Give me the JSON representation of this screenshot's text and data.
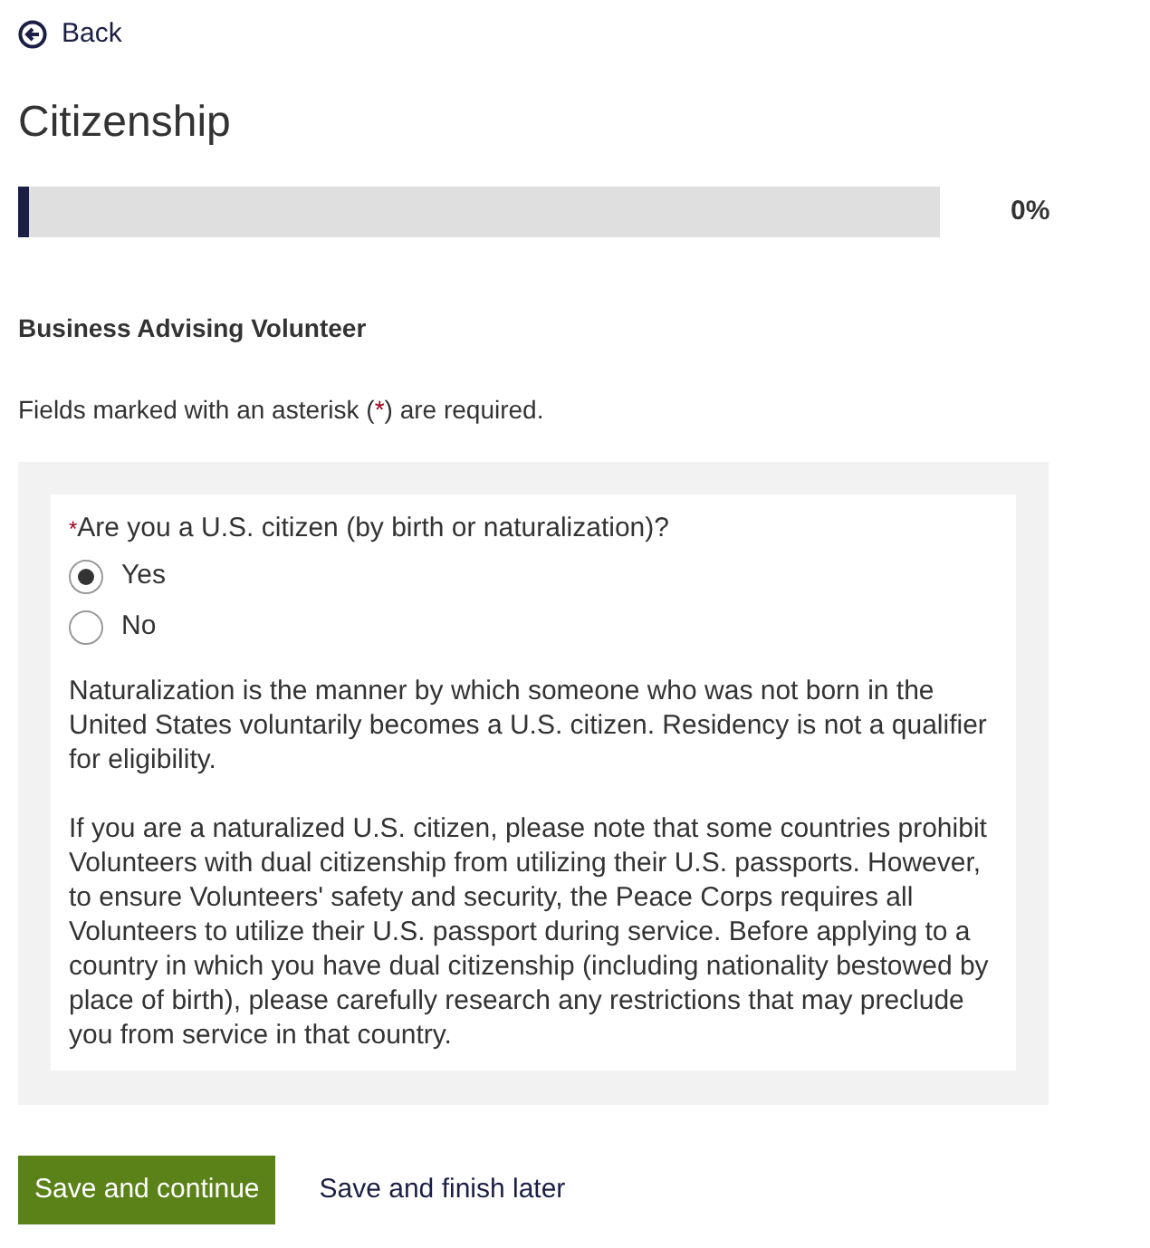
{
  "back_link": {
    "label": "Back"
  },
  "title": "Citizenship",
  "progress": {
    "level": 0,
    "reading": "0%"
  },
  "position": "Business Advising Volunteer",
  "required_note": {
    "before": "Fields marked with an asterisk (",
    "mark": "*",
    "after": ") are required."
  },
  "question": {
    "required_mark": "*",
    "label": "Are you a U.S. citizen (by birth or naturalization)?",
    "options": [
      {
        "label": "Yes",
        "selected": true
      },
      {
        "label": "No",
        "selected": false
      }
    ],
    "help": [
      "Naturalization is the manner by which someone who was not born in the United States voluntarily becomes a U.S. citizen. Residency is not a qualifier for eligibility.",
      "If you are a naturalized U.S. citizen, please note that some countries prohibit Volunteers with dual citizenship from utilizing their U.S. passports. However, to ensure Volunteers' safety and security, the Peace Corps requires all Volunteers to utilize their U.S. passport during service. Before applying to a country in which you have dual citizenship (including nationality bestowed by place of birth), please carefully research any restrictions that may preclude you from service in that country."
    ]
  },
  "buttons": [
    {
      "label": "Save and continue",
      "kind": "primary"
    },
    {
      "label": "Save and finish later",
      "kind": "link"
    }
  ]
}
